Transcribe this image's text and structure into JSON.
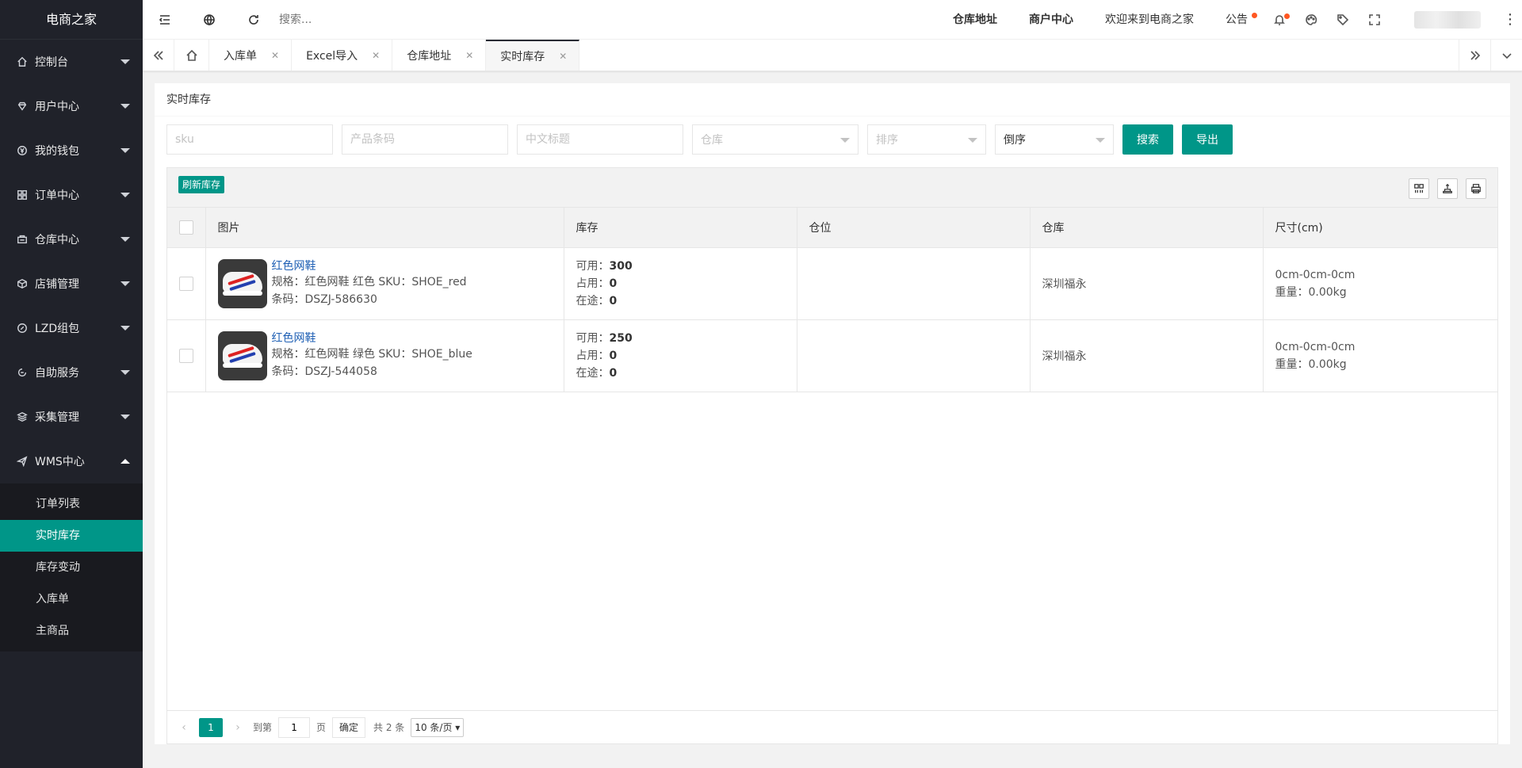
{
  "sidebar": {
    "logo": "电商之家",
    "items": [
      {
        "label": "控制台",
        "icon": "home-icon"
      },
      {
        "label": "用户中心",
        "icon": "diamond-icon"
      },
      {
        "label": "我的钱包",
        "icon": "yen-icon"
      },
      {
        "label": "订单中心",
        "icon": "app-icon"
      },
      {
        "label": "仓库中心",
        "icon": "storage-icon"
      },
      {
        "label": "店铺管理",
        "icon": "cube-icon"
      },
      {
        "label": "LZD组包",
        "icon": "compass-icon"
      },
      {
        "label": "自助服务",
        "icon": "service-icon"
      },
      {
        "label": "采集管理",
        "icon": "layers-icon"
      },
      {
        "label": "WMS中心",
        "icon": "send-icon"
      }
    ],
    "wms_sub": [
      "订单列表",
      "实时库存",
      "库存变动",
      "入库单",
      "主商品"
    ],
    "active_sub": "实时库存"
  },
  "header": {
    "search_placeholder": "搜索...",
    "links": [
      "仓库地址",
      "商户中心",
      "欢迎来到电商之家",
      "公告"
    ]
  },
  "tabs": [
    "入库单",
    "Excel导入",
    "仓库地址",
    "实时库存"
  ],
  "active_tab": "实时库存",
  "page": {
    "title": "实时库存",
    "filters": {
      "sku_placeholder": "sku",
      "barcode_placeholder": "产品条码",
      "title_placeholder": "中文标题",
      "warehouse_placeholder": "仓库",
      "sort_placeholder": "排序",
      "order_value": "倒序",
      "search_label": "搜索",
      "export_label": "导出"
    },
    "refresh_label": "刷新库存",
    "columns": [
      "图片",
      "库存",
      "仓位",
      "仓库",
      "尺寸(cm)"
    ],
    "rows": [
      {
        "name": "红色网鞋",
        "spec": "规格：红色网鞋 红色  SKU：SHOE_red",
        "barcode": "条码：DSZJ-586630",
        "available_label": "可用：",
        "available": "300",
        "occupied_label": "占用：",
        "occupied": "0",
        "transit_label": "在途：",
        "transit": "0",
        "location": "",
        "warehouse": "深圳福永",
        "size": "0cm-0cm-0cm",
        "weight": "重量：0.00kg"
      },
      {
        "name": "红色网鞋",
        "spec": "规格：红色网鞋 绿色  SKU：SHOE_blue",
        "barcode": "条码：DSZJ-544058",
        "available_label": "可用：",
        "available": "250",
        "occupied_label": "占用：",
        "occupied": "0",
        "transit_label": "在途：",
        "transit": "0",
        "location": "",
        "warehouse": "深圳福永",
        "size": "0cm-0cm-0cm",
        "weight": "重量：0.00kg"
      }
    ],
    "pager": {
      "current": "1",
      "goto_label": "到第",
      "goto_value": "1",
      "page_label": "页",
      "confirm_label": "确定",
      "total_label": "共 2 条",
      "per_page": "10 条/页"
    }
  },
  "colors": {
    "accent": "#009688",
    "sidebar_bg": "#20222a",
    "link": "#1e5fb4",
    "dot": "#ff5722"
  }
}
